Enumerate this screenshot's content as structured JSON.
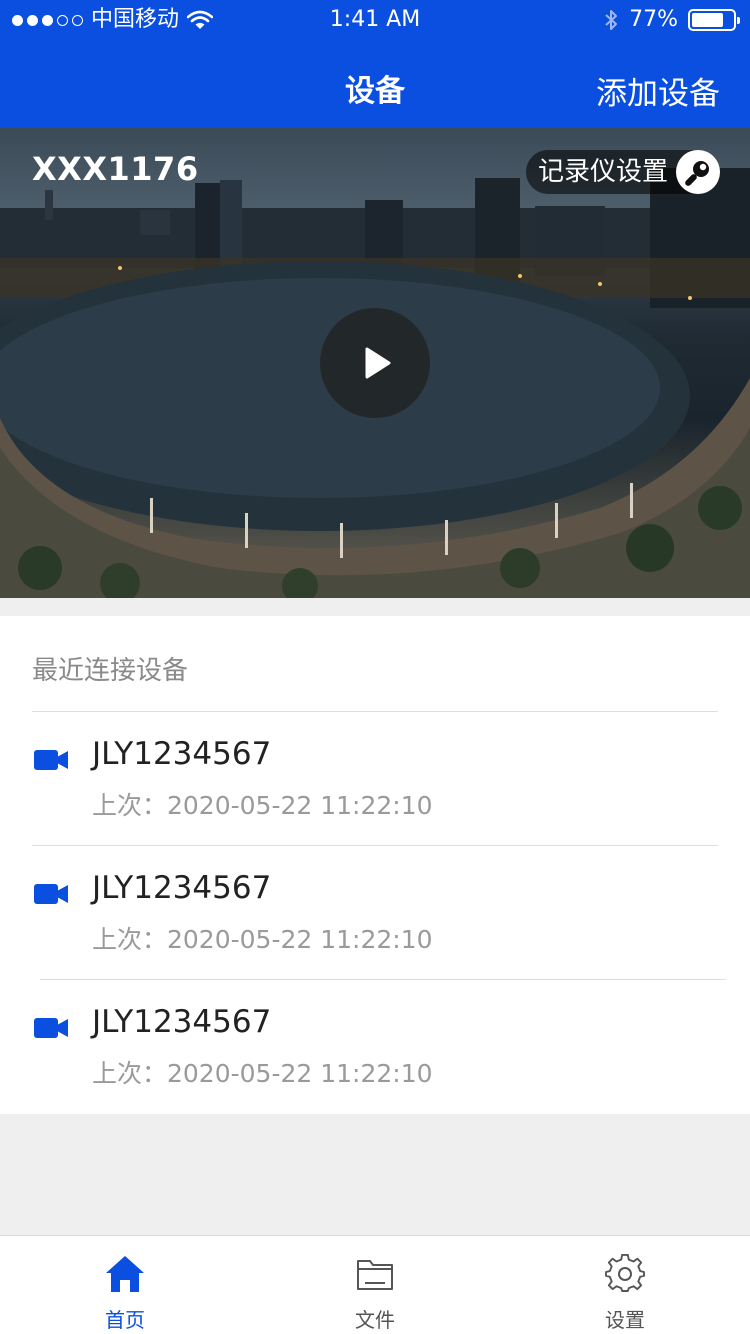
{
  "status_bar": {
    "carrier": "中国移动",
    "time": "1:41 AM",
    "battery": "77%",
    "battery_level": 0.77
  },
  "nav": {
    "title": "设备",
    "action": "添加设备"
  },
  "hero": {
    "device_name": "XXX1176",
    "settings_label": "记录仪设置"
  },
  "recent": {
    "title": "最近连接设备",
    "items": [
      {
        "id": "JLY1234567",
        "last": "上次：2020-05-22   11:22:10"
      },
      {
        "id": "JLY1234567",
        "last": "上次：2020-05-22   11:22:10"
      },
      {
        "id": "JLY1234567",
        "last": "上次：2020-05-22   11:22:10"
      }
    ]
  },
  "tabs": [
    {
      "label": "首页",
      "icon": "home-icon",
      "active": true
    },
    {
      "label": "文件",
      "icon": "folder-icon",
      "active": false
    },
    {
      "label": "设置",
      "icon": "gear-icon",
      "active": false
    }
  ],
  "colors": {
    "brand": "#0b4fe0",
    "muted_text": "#9a9a9a"
  }
}
